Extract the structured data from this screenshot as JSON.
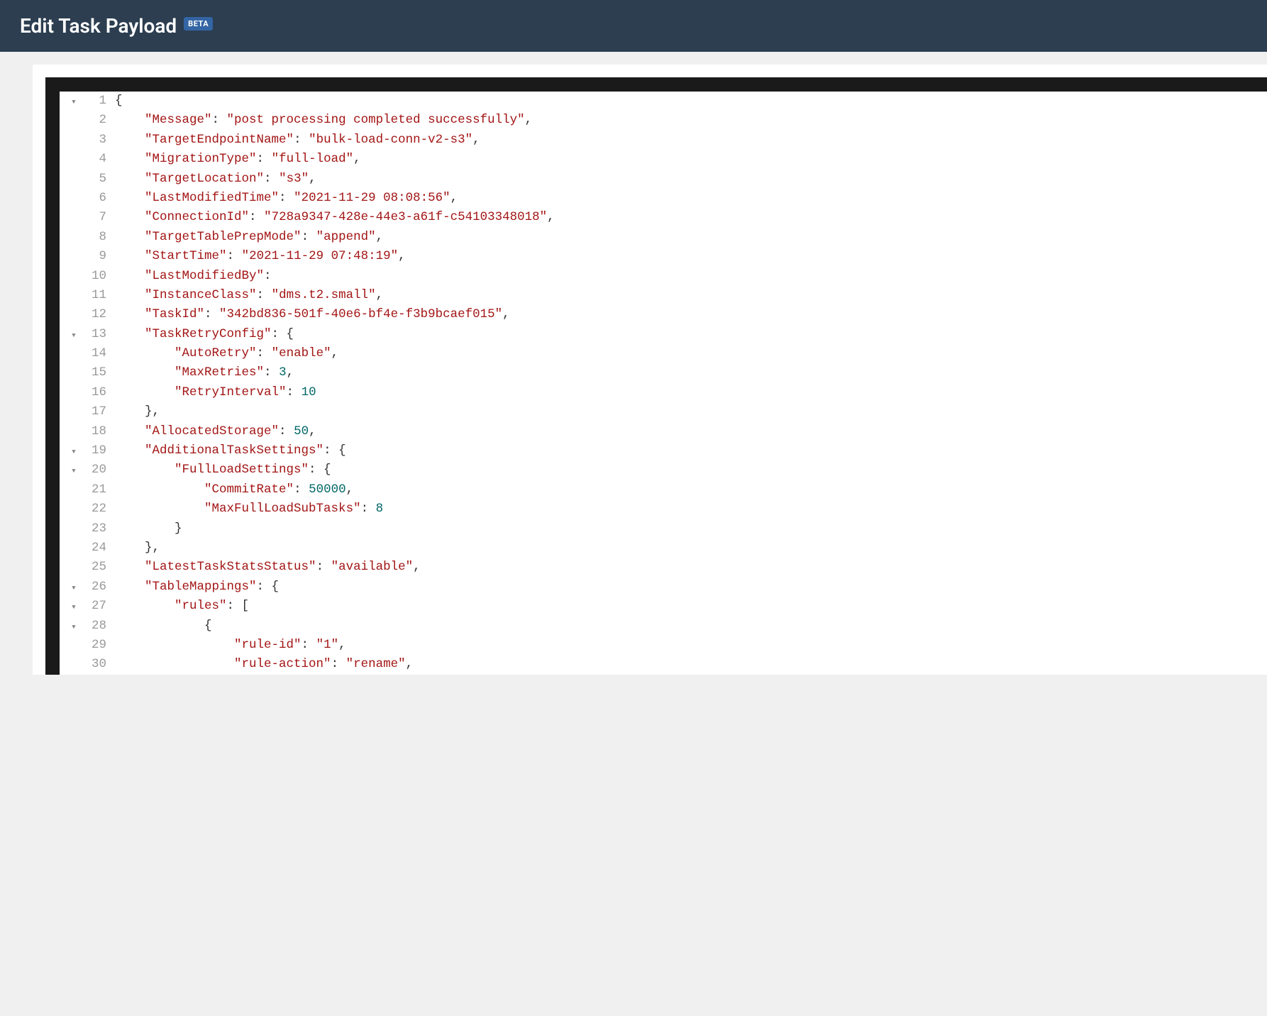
{
  "header": {
    "title": "Edit Task Payload",
    "badge": "BETA"
  },
  "editor": {
    "lines": [
      {
        "num": 1,
        "fold": "▼",
        "html": "<span class='p'>{</span>"
      },
      {
        "num": 2,
        "fold": "",
        "html": "    <span class='k'>\"Message\"</span><span class='p'>: </span><span class='s'>\"post processing completed successfully\"</span><span class='p'>,</span>"
      },
      {
        "num": 3,
        "fold": "",
        "html": "    <span class='k'>\"TargetEndpointName\"</span><span class='p'>: </span><span class='s'>\"bulk-load-conn-v2-s3\"</span><span class='p'>,</span>"
      },
      {
        "num": 4,
        "fold": "",
        "html": "    <span class='k'>\"MigrationType\"</span><span class='p'>: </span><span class='s'>\"full-load\"</span><span class='p'>,</span>"
      },
      {
        "num": 5,
        "fold": "",
        "html": "    <span class='k'>\"TargetLocation\"</span><span class='p'>: </span><span class='s'>\"s3\"</span><span class='p'>,</span>"
      },
      {
        "num": 6,
        "fold": "",
        "html": "    <span class='k'>\"LastModifiedTime\"</span><span class='p'>: </span><span class='s'>\"2021-11-29 08:08:56\"</span><span class='p'>,</span>"
      },
      {
        "num": 7,
        "fold": "",
        "html": "    <span class='k'>\"ConnectionId\"</span><span class='p'>: </span><span class='s'>\"728a9347-428e-44e3-a61f-c54103348018\"</span><span class='p'>,</span>"
      },
      {
        "num": 8,
        "fold": "",
        "html": "    <span class='k'>\"TargetTablePrepMode\"</span><span class='p'>: </span><span class='s'>\"append\"</span><span class='p'>,</span>"
      },
      {
        "num": 9,
        "fold": "",
        "html": "    <span class='k'>\"StartTime\"</span><span class='p'>: </span><span class='s'>\"2021-11-29 07:48:19\"</span><span class='p'>,</span>"
      },
      {
        "num": 10,
        "fold": "",
        "html": "    <span class='k'>\"LastModifiedBy\"</span><span class='p'>:</span>"
      },
      {
        "num": 11,
        "fold": "",
        "html": "    <span class='k'>\"InstanceClass\"</span><span class='p'>: </span><span class='s'>\"dms.t2.small\"</span><span class='p'>,</span>"
      },
      {
        "num": 12,
        "fold": "",
        "html": "    <span class='k'>\"TaskId\"</span><span class='p'>: </span><span class='s'>\"342bd836-501f-40e6-bf4e-f3b9bcaef015\"</span><span class='p'>,</span>"
      },
      {
        "num": 13,
        "fold": "▼",
        "html": "    <span class='k'>\"TaskRetryConfig\"</span><span class='p'>: {</span>"
      },
      {
        "num": 14,
        "fold": "",
        "html": "        <span class='k'>\"AutoRetry\"</span><span class='p'>: </span><span class='s'>\"enable\"</span><span class='p'>,</span>"
      },
      {
        "num": 15,
        "fold": "",
        "html": "        <span class='k'>\"MaxRetries\"</span><span class='p'>: </span><span class='n'>3</span><span class='p'>,</span>"
      },
      {
        "num": 16,
        "fold": "",
        "html": "        <span class='k'>\"RetryInterval\"</span><span class='p'>: </span><span class='n'>10</span>"
      },
      {
        "num": 17,
        "fold": "",
        "html": "    <span class='p'>},</span>"
      },
      {
        "num": 18,
        "fold": "",
        "html": "    <span class='k'>\"AllocatedStorage\"</span><span class='p'>: </span><span class='n'>50</span><span class='p'>,</span>"
      },
      {
        "num": 19,
        "fold": "▼",
        "html": "    <span class='k'>\"AdditionalTaskSettings\"</span><span class='p'>: {</span>"
      },
      {
        "num": 20,
        "fold": "▼",
        "html": "        <span class='k'>\"FullLoadSettings\"</span><span class='p'>: {</span>"
      },
      {
        "num": 21,
        "fold": "",
        "html": "            <span class='k'>\"CommitRate\"</span><span class='p'>: </span><span class='n'>50000</span><span class='p'>,</span>"
      },
      {
        "num": 22,
        "fold": "",
        "html": "            <span class='k'>\"MaxFullLoadSubTasks\"</span><span class='p'>: </span><span class='n'>8</span>"
      },
      {
        "num": 23,
        "fold": "",
        "html": "        <span class='p'>}</span>"
      },
      {
        "num": 24,
        "fold": "",
        "html": "    <span class='p'>},</span>"
      },
      {
        "num": 25,
        "fold": "",
        "html": "    <span class='k'>\"LatestTaskStatsStatus\"</span><span class='p'>: </span><span class='s'>\"available\"</span><span class='p'>,</span>"
      },
      {
        "num": 26,
        "fold": "▼",
        "html": "    <span class='k'>\"TableMappings\"</span><span class='p'>: {</span>"
      },
      {
        "num": 27,
        "fold": "▼",
        "html": "        <span class='k'>\"rules\"</span><span class='p'>: [</span>"
      },
      {
        "num": 28,
        "fold": "▼",
        "html": "            <span class='p'>{</span>"
      },
      {
        "num": 29,
        "fold": "",
        "html": "                <span class='k'>\"rule-id\"</span><span class='p'>: </span><span class='s'>\"1\"</span><span class='p'>,</span>"
      },
      {
        "num": 30,
        "fold": "",
        "html": "                <span class='k'>\"rule-action\"</span><span class='p'>: </span><span class='s'>\"rename\"</span><span class='p'>,</span>"
      }
    ],
    "payload": {
      "Message": "post processing completed successfully",
      "TargetEndpointName": "bulk-load-conn-v2-s3",
      "MigrationType": "full-load",
      "TargetLocation": "s3",
      "LastModifiedTime": "2021-11-29 08:08:56",
      "ConnectionId": "728a9347-428e-44e3-a61f-c54103348018",
      "TargetTablePrepMode": "append",
      "StartTime": "2021-11-29 07:48:19",
      "LastModifiedBy": "",
      "InstanceClass": "dms.t2.small",
      "TaskId": "342bd836-501f-40e6-bf4e-f3b9bcaef015",
      "TaskRetryConfig": {
        "AutoRetry": "enable",
        "MaxRetries": 3,
        "RetryInterval": 10
      },
      "AllocatedStorage": 50,
      "AdditionalTaskSettings": {
        "FullLoadSettings": {
          "CommitRate": 50000,
          "MaxFullLoadSubTasks": 8
        }
      },
      "LatestTaskStatsStatus": "available",
      "TableMappings": {
        "rules": [
          {
            "rule-id": "1",
            "rule-action": "rename"
          }
        ]
      }
    }
  }
}
